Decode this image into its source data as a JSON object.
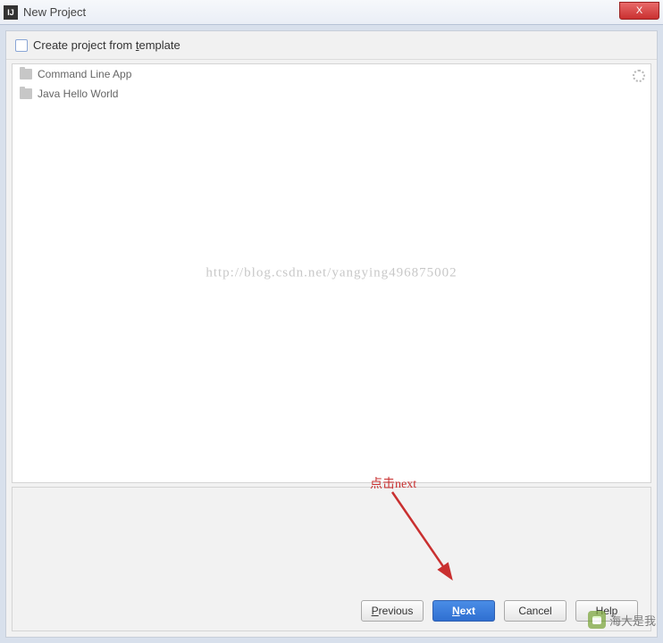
{
  "titlebar": {
    "title": "New Project",
    "close_icon": "X"
  },
  "header": {
    "checkbox_label_pre": "Create project from ",
    "checkbox_label_underlined": "t",
    "checkbox_label_post": "emplate"
  },
  "templates": [
    {
      "label": "Command Line App"
    },
    {
      "label": "Java Hello World"
    }
  ],
  "watermark_url": "http://blog.csdn.net/yangying496875002",
  "annotation_text": "点击next",
  "buttons": {
    "previous": "Previous",
    "next": "Next",
    "cancel": "Cancel",
    "help": "Help"
  },
  "corner_badge": "海大是我"
}
